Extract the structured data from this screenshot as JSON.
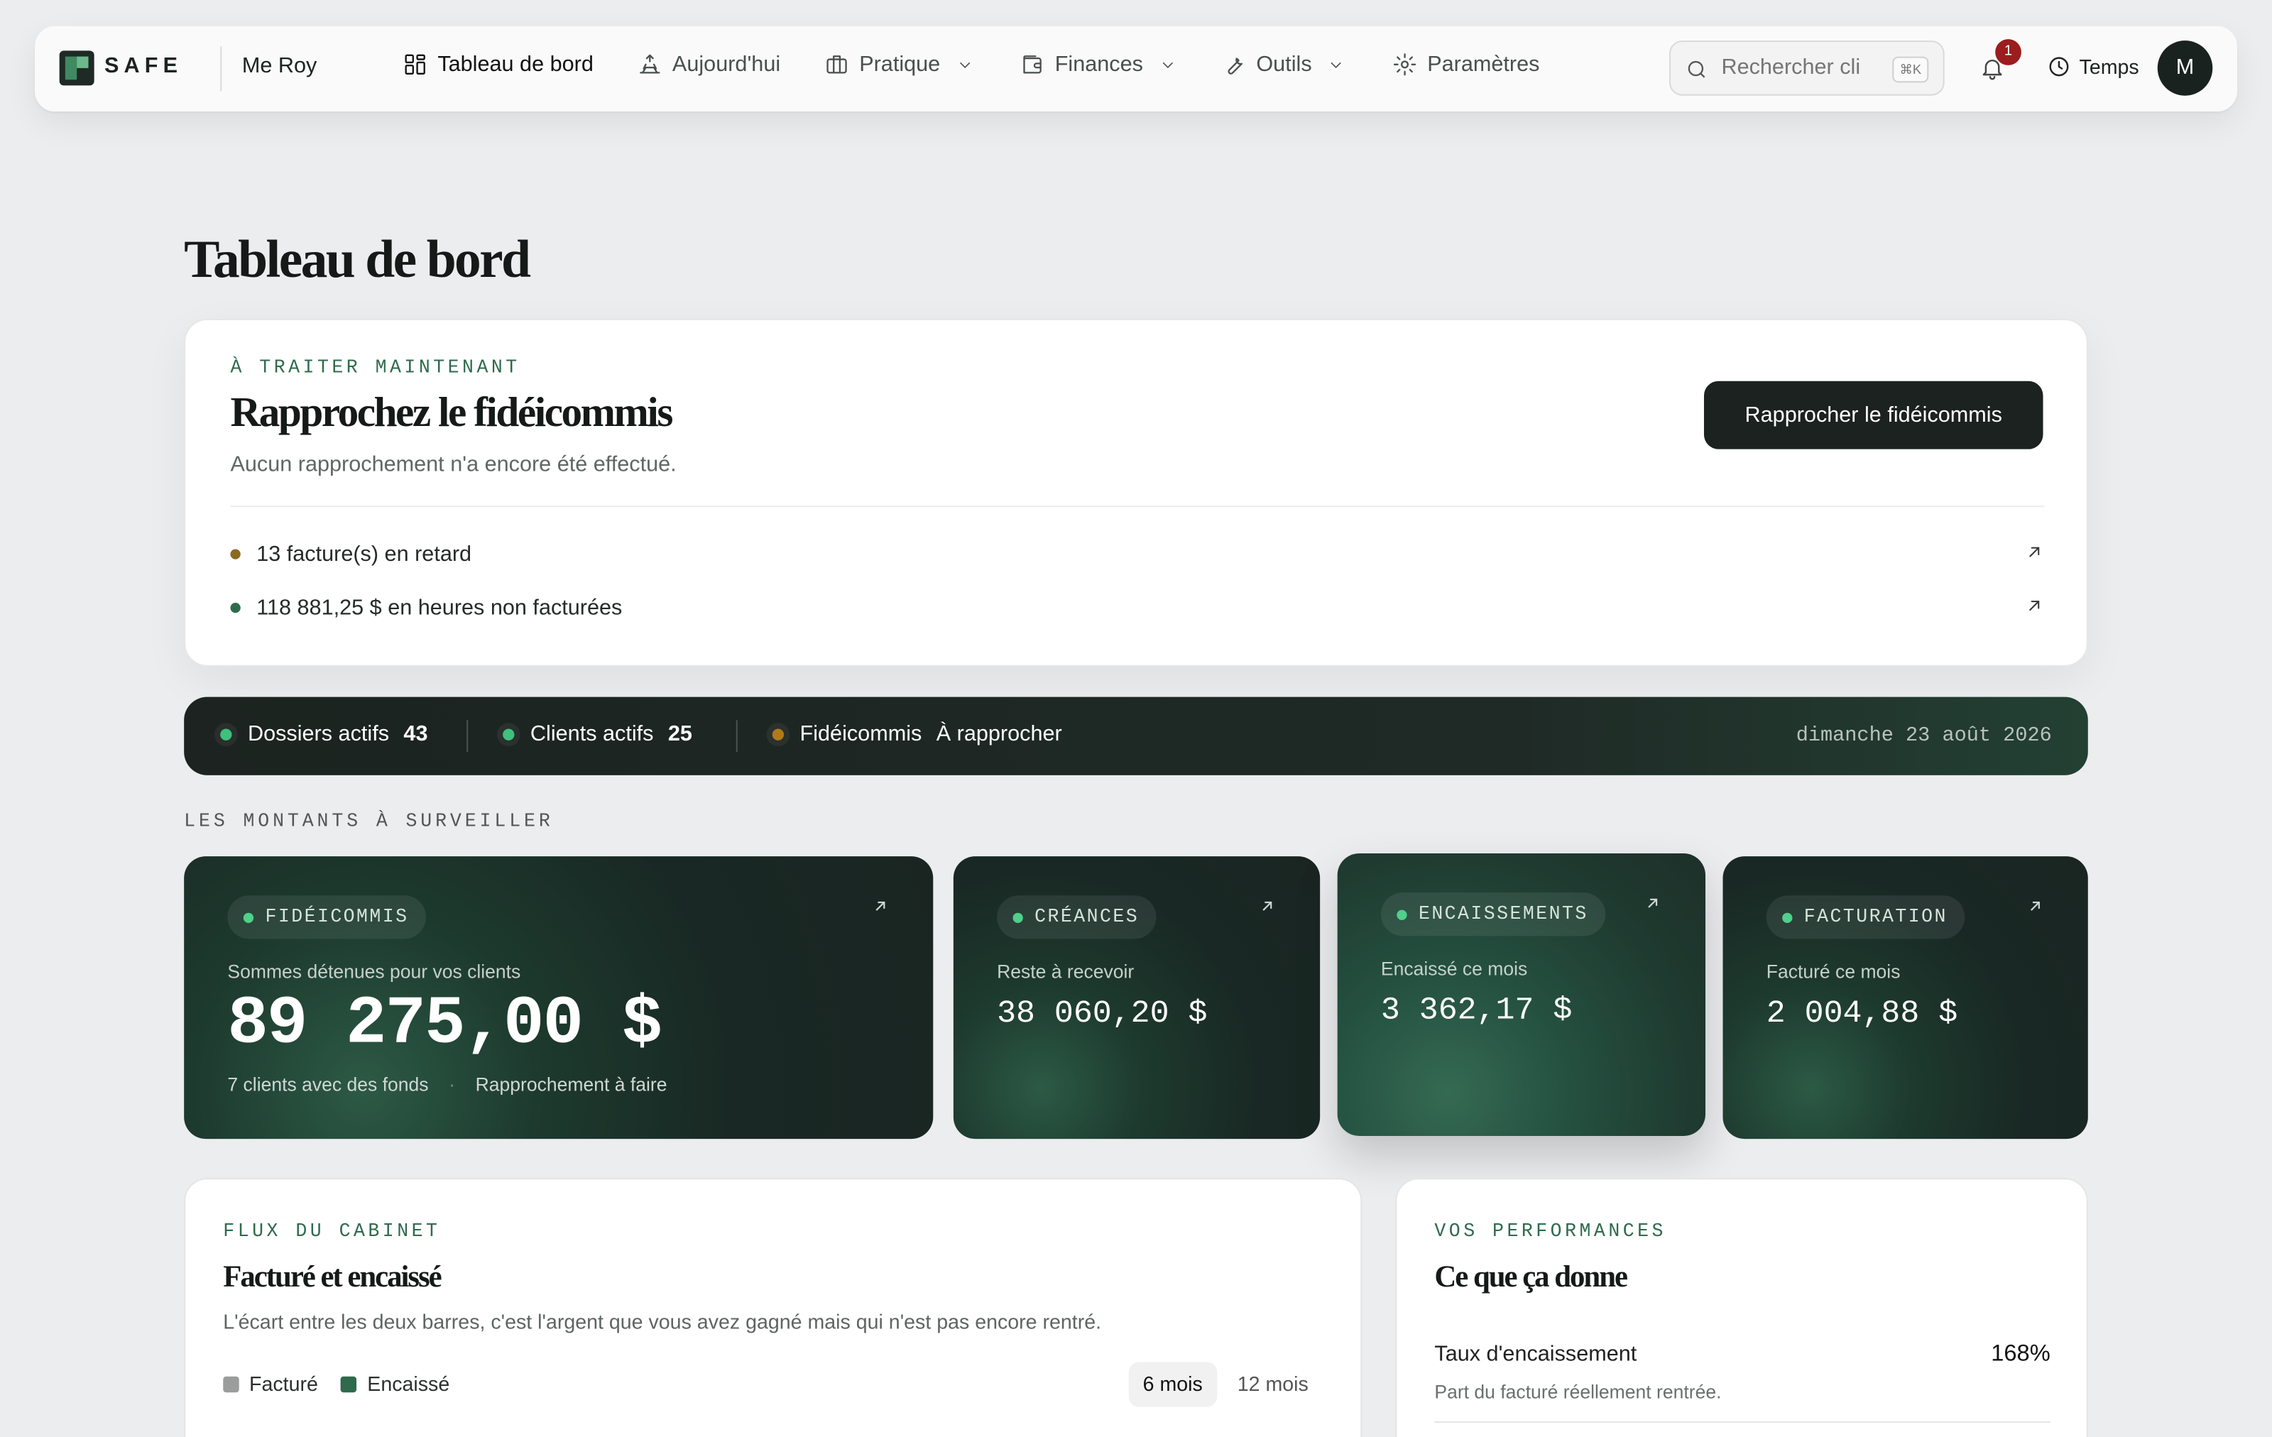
{
  "nav": {
    "brand": "SAFE",
    "firm": "Me Roy",
    "items": [
      {
        "label": "Tableau de bord",
        "icon": "grid-icon",
        "active": true
      },
      {
        "label": "Aujourd'hui",
        "icon": "sunrise-icon"
      },
      {
        "label": "Pratique",
        "icon": "briefcase-icon",
        "dropdown": true
      },
      {
        "label": "Finances",
        "icon": "wallet-icon",
        "dropdown": true
      },
      {
        "label": "Outils",
        "icon": "wrench-icon",
        "dropdown": true
      },
      {
        "label": "Paramètres",
        "icon": "gear-icon"
      }
    ],
    "search_placeholder": "Rechercher client",
    "search_shortcut": "⌘K",
    "notification_count": "1",
    "timer_label": "Temps",
    "avatar_initial": "M"
  },
  "page_title": "Tableau de bord",
  "todo": {
    "eyebrow": "À traiter maintenant",
    "title": "Rapprochez le fidéicommis",
    "subtitle": "Aucun rapprochement n'a encore été effectué.",
    "button": "Rapprocher le fidéicommis",
    "items": [
      {
        "text": "13 facture(s) en retard",
        "dot_color": "#8a6a1f"
      },
      {
        "text": "118 881,25 $ en heures non facturées",
        "dot_color": "#2e6b4c"
      }
    ]
  },
  "status": {
    "items": [
      {
        "label": "Dossiers actifs",
        "value": "43",
        "dot_color": "#3fc07d"
      },
      {
        "label": "Clients actifs",
        "value": "25",
        "dot_color": "#3fc07d"
      },
      {
        "label": "Fidéicommis",
        "value": "À rapprocher",
        "dot_color": "#b07a18"
      }
    ],
    "date": "dimanche 23 août 2026"
  },
  "section_label": "Les montants à surveiller",
  "metrics": [
    {
      "tag": "Fidéicommis",
      "label": "Sommes détenues pour vos clients",
      "value": "89 275,00 $",
      "foot_a": "7 clients avec des fonds",
      "foot_sep": "·",
      "foot_b": "Rapprochement à faire"
    },
    {
      "tag": "Créances",
      "label": "Reste à recevoir",
      "value": "38 060,20 $"
    },
    {
      "tag": "Encaissements",
      "label": "Encaissé ce mois",
      "value": "3 362,17 $"
    },
    {
      "tag": "Facturation",
      "label": "Facturé ce mois",
      "value": "2 004,88 $"
    }
  ],
  "flux": {
    "eyebrow": "Flux du cabinet",
    "title": "Facturé et encaissé",
    "desc": "L'écart entre les deux barres, c'est l'argent que vous avez gagné mais qui n'est pas encore rentré.",
    "legend": [
      {
        "label": "Facturé",
        "color": "#9a9d9b"
      },
      {
        "label": "Encaissé",
        "color": "#2f6a4d"
      }
    ],
    "ranges": [
      "6 mois",
      "12 mois"
    ],
    "selected_range": "6 mois"
  },
  "perf": {
    "eyebrow": "Vos performances",
    "title": "Ce que ça donne",
    "rows": [
      {
        "label": "Taux d'encaissement",
        "value": "168%",
        "desc": "Part du facturé réellement rentrée."
      }
    ]
  },
  "colors": {
    "accent": "#2f6a4d",
    "dark": "#1b2220",
    "notification": "#9b1d1d"
  }
}
